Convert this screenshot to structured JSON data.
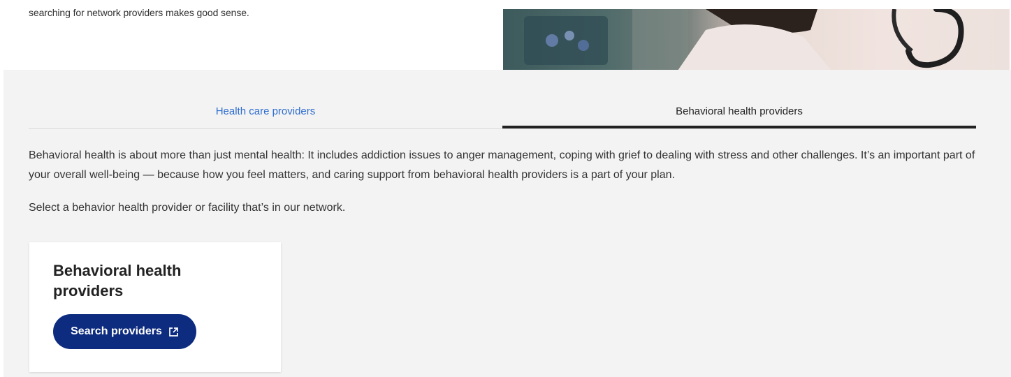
{
  "intro": {
    "text": "searching for network providers makes good sense."
  },
  "tabs": [
    {
      "label": "Health care providers",
      "active": false
    },
    {
      "label": "Behavioral health providers",
      "active": true
    }
  ],
  "content": {
    "paragraph": "Behavioral health is about more than just mental health: It includes addiction issues to anger management, coping with grief to dealing with stress and other challenges. It’s an important part of your overall well-being — because how you feel matters, and caring support from behavioral health providers is a part of your plan.",
    "select_text": "Select a behavior health provider or facility that’s in our network."
  },
  "card": {
    "title": "Behavioral health providers",
    "button_label": "Search providers",
    "button_icon": "external-link-icon"
  },
  "colors": {
    "active_tab_link": "#2d6ccf",
    "button_bg": "#0d2b7f",
    "section_bg": "#f3f3f3"
  }
}
